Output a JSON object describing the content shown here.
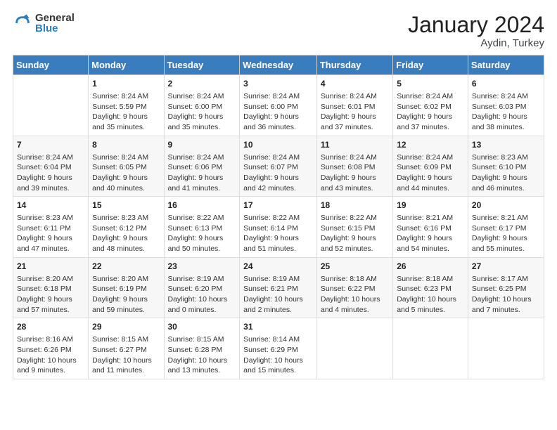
{
  "logo": {
    "general": "General",
    "blue": "Blue"
  },
  "header": {
    "month": "January 2024",
    "location": "Aydin, Turkey"
  },
  "weekdays": [
    "Sunday",
    "Monday",
    "Tuesday",
    "Wednesday",
    "Thursday",
    "Friday",
    "Saturday"
  ],
  "weeks": [
    [
      {
        "day": "",
        "sunrise": "",
        "sunset": "",
        "daylight": ""
      },
      {
        "day": "1",
        "sunrise": "Sunrise: 8:24 AM",
        "sunset": "Sunset: 5:59 PM",
        "daylight": "Daylight: 9 hours and 35 minutes."
      },
      {
        "day": "2",
        "sunrise": "Sunrise: 8:24 AM",
        "sunset": "Sunset: 6:00 PM",
        "daylight": "Daylight: 9 hours and 35 minutes."
      },
      {
        "day": "3",
        "sunrise": "Sunrise: 8:24 AM",
        "sunset": "Sunset: 6:00 PM",
        "daylight": "Daylight: 9 hours and 36 minutes."
      },
      {
        "day": "4",
        "sunrise": "Sunrise: 8:24 AM",
        "sunset": "Sunset: 6:01 PM",
        "daylight": "Daylight: 9 hours and 37 minutes."
      },
      {
        "day": "5",
        "sunrise": "Sunrise: 8:24 AM",
        "sunset": "Sunset: 6:02 PM",
        "daylight": "Daylight: 9 hours and 37 minutes."
      },
      {
        "day": "6",
        "sunrise": "Sunrise: 8:24 AM",
        "sunset": "Sunset: 6:03 PM",
        "daylight": "Daylight: 9 hours and 38 minutes."
      }
    ],
    [
      {
        "day": "7",
        "sunrise": "Sunrise: 8:24 AM",
        "sunset": "Sunset: 6:04 PM",
        "daylight": "Daylight: 9 hours and 39 minutes."
      },
      {
        "day": "8",
        "sunrise": "Sunrise: 8:24 AM",
        "sunset": "Sunset: 6:05 PM",
        "daylight": "Daylight: 9 hours and 40 minutes."
      },
      {
        "day": "9",
        "sunrise": "Sunrise: 8:24 AM",
        "sunset": "Sunset: 6:06 PM",
        "daylight": "Daylight: 9 hours and 41 minutes."
      },
      {
        "day": "10",
        "sunrise": "Sunrise: 8:24 AM",
        "sunset": "Sunset: 6:07 PM",
        "daylight": "Daylight: 9 hours and 42 minutes."
      },
      {
        "day": "11",
        "sunrise": "Sunrise: 8:24 AM",
        "sunset": "Sunset: 6:08 PM",
        "daylight": "Daylight: 9 hours and 43 minutes."
      },
      {
        "day": "12",
        "sunrise": "Sunrise: 8:24 AM",
        "sunset": "Sunset: 6:09 PM",
        "daylight": "Daylight: 9 hours and 44 minutes."
      },
      {
        "day": "13",
        "sunrise": "Sunrise: 8:23 AM",
        "sunset": "Sunset: 6:10 PM",
        "daylight": "Daylight: 9 hours and 46 minutes."
      }
    ],
    [
      {
        "day": "14",
        "sunrise": "Sunrise: 8:23 AM",
        "sunset": "Sunset: 6:11 PM",
        "daylight": "Daylight: 9 hours and 47 minutes."
      },
      {
        "day": "15",
        "sunrise": "Sunrise: 8:23 AM",
        "sunset": "Sunset: 6:12 PM",
        "daylight": "Daylight: 9 hours and 48 minutes."
      },
      {
        "day": "16",
        "sunrise": "Sunrise: 8:22 AM",
        "sunset": "Sunset: 6:13 PM",
        "daylight": "Daylight: 9 hours and 50 minutes."
      },
      {
        "day": "17",
        "sunrise": "Sunrise: 8:22 AM",
        "sunset": "Sunset: 6:14 PM",
        "daylight": "Daylight: 9 hours and 51 minutes."
      },
      {
        "day": "18",
        "sunrise": "Sunrise: 8:22 AM",
        "sunset": "Sunset: 6:15 PM",
        "daylight": "Daylight: 9 hours and 52 minutes."
      },
      {
        "day": "19",
        "sunrise": "Sunrise: 8:21 AM",
        "sunset": "Sunset: 6:16 PM",
        "daylight": "Daylight: 9 hours and 54 minutes."
      },
      {
        "day": "20",
        "sunrise": "Sunrise: 8:21 AM",
        "sunset": "Sunset: 6:17 PM",
        "daylight": "Daylight: 9 hours and 55 minutes."
      }
    ],
    [
      {
        "day": "21",
        "sunrise": "Sunrise: 8:20 AM",
        "sunset": "Sunset: 6:18 PM",
        "daylight": "Daylight: 9 hours and 57 minutes."
      },
      {
        "day": "22",
        "sunrise": "Sunrise: 8:20 AM",
        "sunset": "Sunset: 6:19 PM",
        "daylight": "Daylight: 9 hours and 59 minutes."
      },
      {
        "day": "23",
        "sunrise": "Sunrise: 8:19 AM",
        "sunset": "Sunset: 6:20 PM",
        "daylight": "Daylight: 10 hours and 0 minutes."
      },
      {
        "day": "24",
        "sunrise": "Sunrise: 8:19 AM",
        "sunset": "Sunset: 6:21 PM",
        "daylight": "Daylight: 10 hours and 2 minutes."
      },
      {
        "day": "25",
        "sunrise": "Sunrise: 8:18 AM",
        "sunset": "Sunset: 6:22 PM",
        "daylight": "Daylight: 10 hours and 4 minutes."
      },
      {
        "day": "26",
        "sunrise": "Sunrise: 8:18 AM",
        "sunset": "Sunset: 6:23 PM",
        "daylight": "Daylight: 10 hours and 5 minutes."
      },
      {
        "day": "27",
        "sunrise": "Sunrise: 8:17 AM",
        "sunset": "Sunset: 6:25 PM",
        "daylight": "Daylight: 10 hours and 7 minutes."
      }
    ],
    [
      {
        "day": "28",
        "sunrise": "Sunrise: 8:16 AM",
        "sunset": "Sunset: 6:26 PM",
        "daylight": "Daylight: 10 hours and 9 minutes."
      },
      {
        "day": "29",
        "sunrise": "Sunrise: 8:15 AM",
        "sunset": "Sunset: 6:27 PM",
        "daylight": "Daylight: 10 hours and 11 minutes."
      },
      {
        "day": "30",
        "sunrise": "Sunrise: 8:15 AM",
        "sunset": "Sunset: 6:28 PM",
        "daylight": "Daylight: 10 hours and 13 minutes."
      },
      {
        "day": "31",
        "sunrise": "Sunrise: 8:14 AM",
        "sunset": "Sunset: 6:29 PM",
        "daylight": "Daylight: 10 hours and 15 minutes."
      },
      {
        "day": "",
        "sunrise": "",
        "sunset": "",
        "daylight": ""
      },
      {
        "day": "",
        "sunrise": "",
        "sunset": "",
        "daylight": ""
      },
      {
        "day": "",
        "sunrise": "",
        "sunset": "",
        "daylight": ""
      }
    ]
  ]
}
